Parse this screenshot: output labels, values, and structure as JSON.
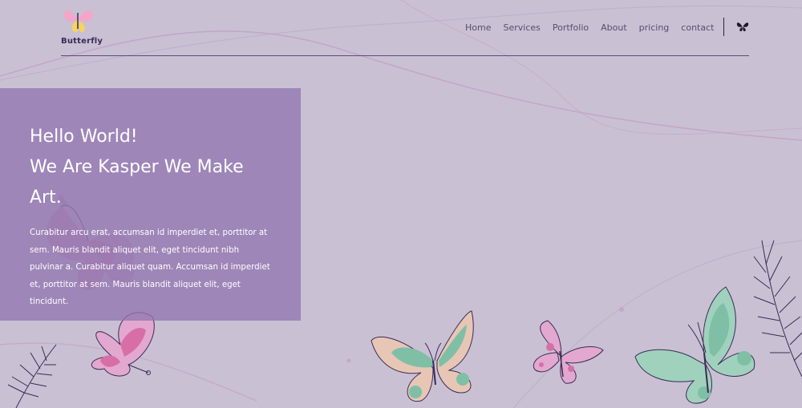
{
  "brand": {
    "logo_text": "Butterfly",
    "logo_icon": "butterfly-icon"
  },
  "nav": {
    "items": [
      "Home",
      "Services",
      "Portfolio",
      "About",
      "pricing",
      "contact"
    ],
    "icon": "butterfly-icon"
  },
  "hero": {
    "title_lines": [
      "Hello World!",
      "We Are Kasper We Make",
      "Art."
    ],
    "paragraph": "Curabitur arcu erat, accumsan id imperdiet et, porttitor at sem. Mauris blandit aliquet elit, eget tincidunt nibh pulvinar a. Curabitur aliquet quam. Accumsan id imperdiet et, porttitor at sem. Mauris blandit aliquet elit, eget tincidunt."
  },
  "colors": {
    "background": "#c9c0d4",
    "hero_box": "#9276b0",
    "nav_text": "#5b4d6e",
    "accent_pink": "#d76fa6",
    "accent_green": "#7fbfa5"
  }
}
